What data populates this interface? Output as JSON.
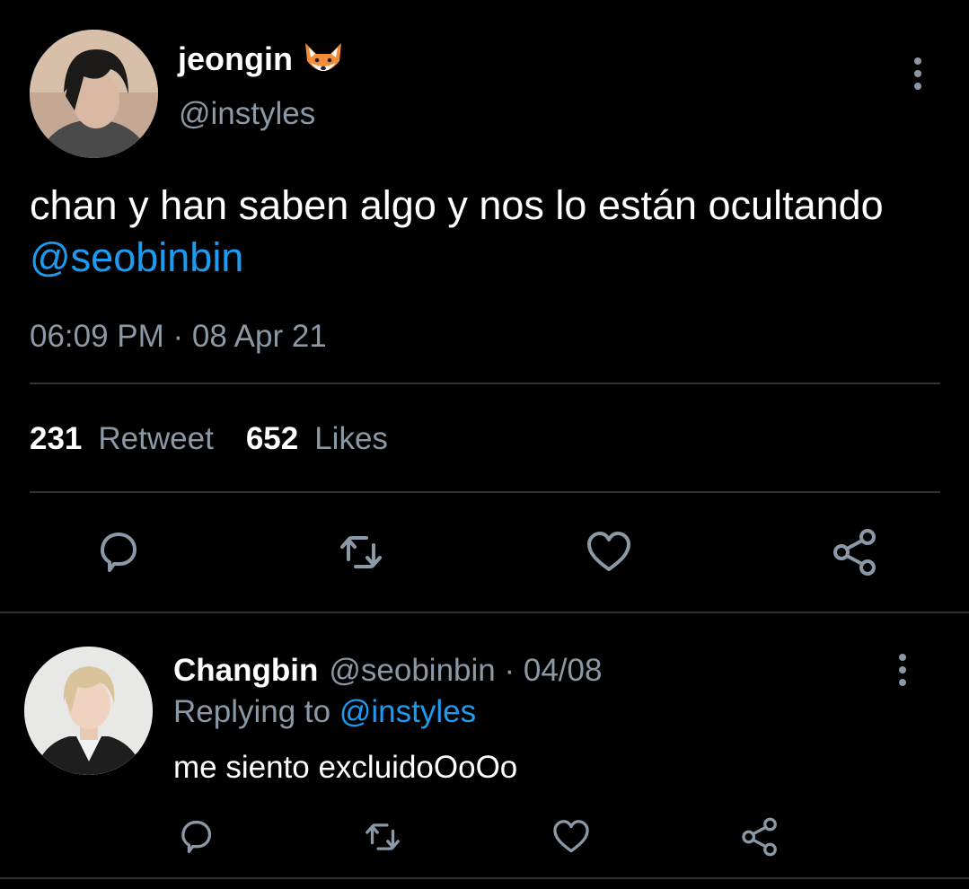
{
  "tweet": {
    "author": {
      "display_name": "jeongin",
      "emoji_icon": "fox-face-icon",
      "handle": "@instyles"
    },
    "text_part1": "chan y han saben algo y nos lo están ocultando ",
    "mention": "@seobinbin",
    "time": "06:09 PM",
    "separator": " · ",
    "date": "08 Apr 21",
    "stats": {
      "retweets_count": "231",
      "retweets_label": "Retweet",
      "likes_count": "652",
      "likes_label": "Likes"
    },
    "actions": [
      "reply-icon",
      "retweet-icon",
      "heart-icon",
      "share-icon"
    ]
  },
  "reply": {
    "display_name": "Changbin",
    "handle": "@seobinbin",
    "separator": " · ",
    "date": "04/08",
    "replying_label": "Replying to ",
    "replying_to": "@instyles",
    "text": "me siento excluidoOoOo",
    "actions": [
      "reply-icon",
      "retweet-icon",
      "heart-icon",
      "share-icon"
    ]
  },
  "colors": {
    "background": "#000000",
    "text": "#ffffff",
    "secondary": "#8b98a5",
    "accent": "#1d9bf0",
    "divider": "#2f3336",
    "icon": "#8b98a5"
  }
}
